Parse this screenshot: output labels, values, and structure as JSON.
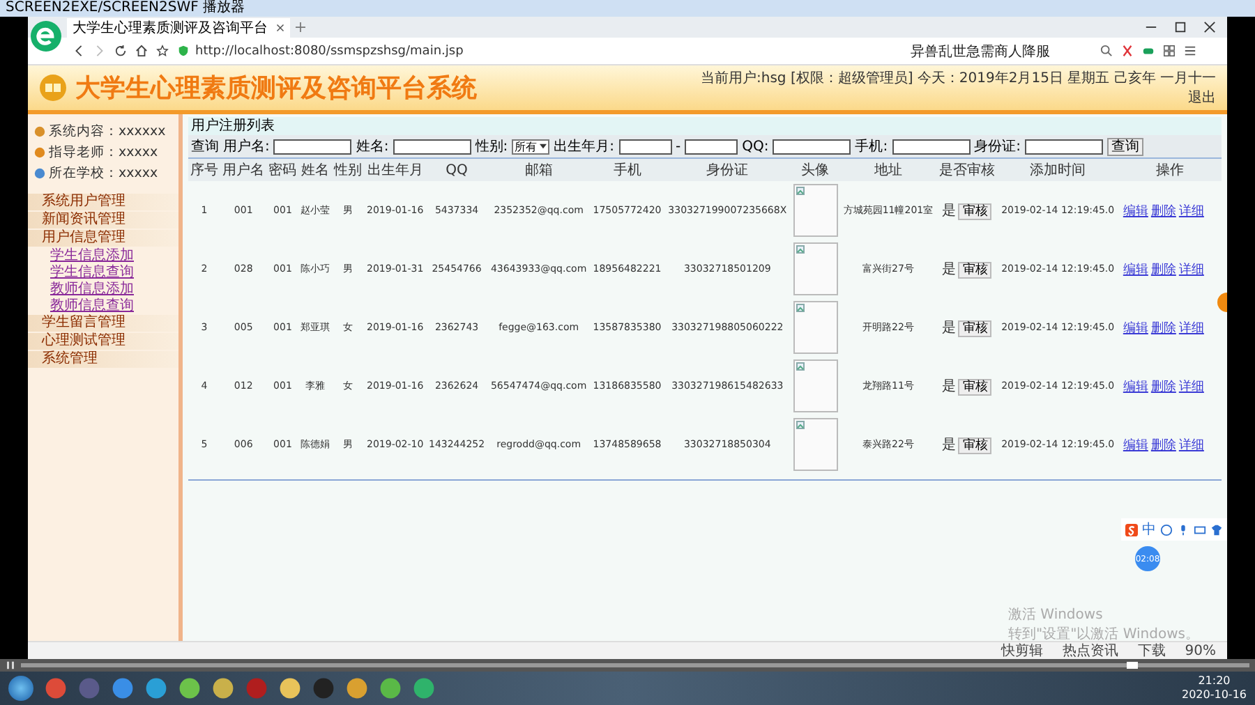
{
  "player": {
    "title": "SCREEN2EXE/SCREEN2SWF 播放器",
    "progress": {
      "level": 0.9
    }
  },
  "browser": {
    "tab": {
      "title": "大学生心理素质测评及咨询平台"
    },
    "url": "http://localhost:8080/ssmspzshsg/main.jsp",
    "search": "异兽乱世急需商人降服",
    "status_items": [
      {
        "label": "快剪辑"
      },
      {
        "label": "热点资讯"
      },
      {
        "label": "下载"
      },
      {
        "label": "90%"
      }
    ]
  },
  "header": {
    "title": "大学生心理素质测评及咨询平台系统",
    "user_info": "当前用户:hsg [权限：超级管理员] 今天：2019年2月15日 星期五 己亥年 一月十一",
    "logout": "退出"
  },
  "sidebar": {
    "info": [
      "系统内容：xxxxxx",
      "指导老师：xxxxx",
      "所在学校：xxxxx"
    ],
    "menu": [
      {
        "label": "系统用户管理"
      },
      {
        "label": "新闻资讯管理"
      },
      {
        "label": "用户信息管理",
        "children": [
          {
            "label": "学生信息添加"
          },
          {
            "label": "学生信息查询"
          },
          {
            "label": "教师信息添加"
          },
          {
            "label": "教师信息查询"
          }
        ]
      },
      {
        "label": "学生留言管理"
      },
      {
        "label": "心理测试管理"
      },
      {
        "label": "系统管理"
      }
    ]
  },
  "content": {
    "title": "用户注册列表",
    "search": {
      "label": "查询",
      "fields": [
        {
          "label": "用户名:",
          "kind": "text"
        },
        {
          "label": "姓名:",
          "kind": "text"
        },
        {
          "label": "性别:",
          "kind": "select",
          "value": "所有"
        },
        {
          "label": "出生年月:",
          "kind": "range",
          "separator": "-"
        },
        {
          "label": "QQ:",
          "kind": "text"
        },
        {
          "label": "手机:",
          "kind": "text"
        },
        {
          "label": "身份证:",
          "kind": "text"
        }
      ],
      "button": "查询"
    },
    "table": {
      "columns": [
        "序号",
        "用户名",
        "密码",
        "姓名",
        "性别",
        "出生年月",
        "QQ",
        "邮箱",
        "手机",
        "身份证",
        "头像",
        "地址",
        "是否审核",
        "添加时间",
        "操作"
      ],
      "rows": [
        {
          "no": "1",
          "username": "001",
          "password": "001",
          "name": "赵小莹",
          "gender": "男",
          "birth": "2019-01-16",
          "qq": "5437334",
          "email": "2352352@qq.com",
          "phone": "17505772420",
          "id_card": "330327199007235668X",
          "avatar": {
            "kind": "broken_image"
          },
          "address": "方城苑园11幢201室",
          "audited": "是",
          "audit_button": "审核",
          "added": "2019-02-14 12:19:45.0",
          "actions": [
            "编辑",
            "删除",
            "详细"
          ]
        },
        {
          "no": "2",
          "username": "028",
          "password": "001",
          "name": "陈小巧",
          "gender": "男",
          "birth": "2019-01-31",
          "qq": "25454766",
          "email": "43643933@qq.com",
          "phone": "18956482221",
          "id_card": "33032718501209",
          "avatar": {
            "kind": "broken_image"
          },
          "address": "富兴街27号",
          "audited": "是",
          "audit_button": "审核",
          "added": "2019-02-14 12:19:45.0",
          "actions": [
            "编辑",
            "删除",
            "详细"
          ]
        },
        {
          "no": "3",
          "username": "005",
          "password": "001",
          "name": "郑亚琪",
          "gender": "女",
          "birth": "2019-01-16",
          "qq": "2362743",
          "email": "fegge@163.com",
          "phone": "13587835380",
          "id_card": "330327198805060222",
          "avatar": {
            "kind": "broken_image"
          },
          "address": "开明路22号",
          "audited": "是",
          "audit_button": "审核",
          "added": "2019-02-14 12:19:45.0",
          "actions": [
            "编辑",
            "删除",
            "详细"
          ]
        },
        {
          "no": "4",
          "username": "012",
          "password": "001",
          "name": "李雅",
          "gender": "女",
          "birth": "2019-01-16",
          "qq": "2362624",
          "email": "56547474@qq.com",
          "phone": "13186835580",
          "id_card": "330327198615482633",
          "avatar": {
            "kind": "broken_image"
          },
          "address": "龙翔路11号",
          "audited": "是",
          "audit_button": "审核",
          "added": "2019-02-14 12:19:45.0",
          "actions": [
            "编辑",
            "删除",
            "详细"
          ]
        },
        {
          "no": "5",
          "username": "006",
          "password": "001",
          "name": "陈德娟",
          "gender": "男",
          "birth": "2019-02-10",
          "qq": "143244252",
          "email": "regrodd@qq.com",
          "phone": "13748589658",
          "id_card": "33032718850304",
          "avatar": {
            "kind": "broken_image"
          },
          "address": "泰兴路22号",
          "audited": "是",
          "audit_button": "审核",
          "added": "2019-02-14 12:19:45.0",
          "actions": [
            "编辑",
            "删除",
            "详细"
          ]
        }
      ]
    }
  },
  "overlays": {
    "ime_label": "中",
    "timer": "02:08",
    "activation_title": "激活 Windows",
    "activation_hint": "转到\"设置\"以激活 Windows。"
  },
  "taskbar": {
    "time": "21:20",
    "date": "2020-10-16"
  }
}
